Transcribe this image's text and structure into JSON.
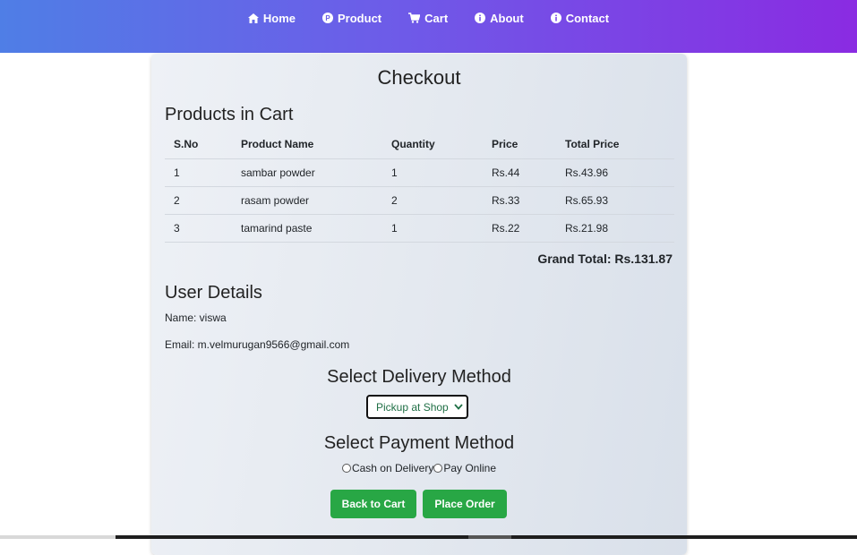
{
  "nav": {
    "items": [
      {
        "label": "Home",
        "icon": "home-icon"
      },
      {
        "label": "Product",
        "icon": "product-icon"
      },
      {
        "label": "Cart",
        "icon": "cart-icon"
      },
      {
        "label": "About",
        "icon": "info-icon"
      },
      {
        "label": "Contact",
        "icon": "info-icon"
      }
    ]
  },
  "checkout": {
    "title": "Checkout",
    "products_heading": "Products in Cart",
    "columns": [
      "S.No",
      "Product Name",
      "Quantity",
      "Price",
      "Total Price"
    ],
    "rows": [
      [
        "1",
        "sambar powder",
        "1",
        "Rs.44",
        "Rs.43.96"
      ],
      [
        "2",
        "rasam powder",
        "2",
        "Rs.33",
        "Rs.65.93"
      ],
      [
        "3",
        "tamarind paste",
        "1",
        "Rs.22",
        "Rs.21.98"
      ]
    ],
    "grand_total": "Grand Total: Rs.131.87",
    "user_heading": "User Details",
    "name_line": "Name: viswa",
    "email_line": "Email: m.velmurugan9566@gmail.com",
    "delivery_heading": "Select Delivery Method",
    "delivery_selected": "Pickup at Shop",
    "payment_heading": "Select Payment Method",
    "payment_options": [
      "Cash on Delivery",
      "Pay Online"
    ],
    "back_button": "Back to Cart",
    "place_button": "Place Order"
  },
  "colors": {
    "accent": "#28a745",
    "nav_start": "#4f7ee6",
    "nav_end": "#8a2be2"
  }
}
